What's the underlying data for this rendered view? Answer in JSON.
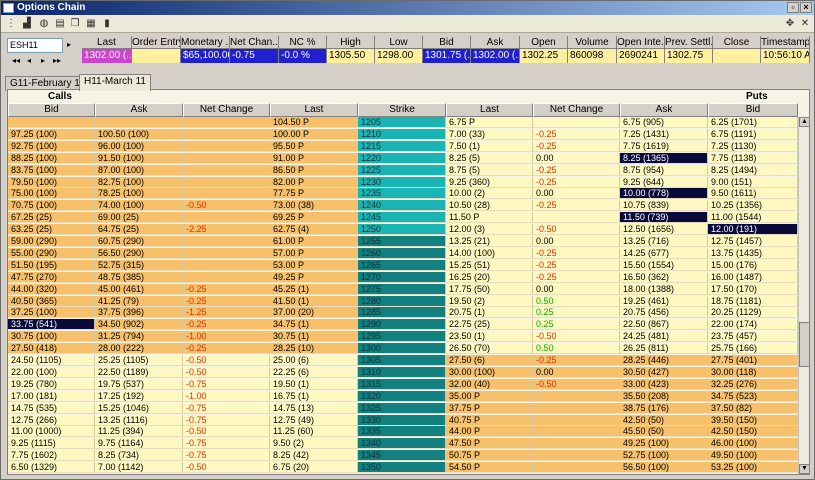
{
  "window": {
    "title": "Options Chain"
  },
  "symbol": {
    "value": "ESH11"
  },
  "quote": {
    "headers": [
      "Last",
      "Order Entry",
      "Monetary ...",
      "Net Chan...",
      "NC %",
      "High",
      "Low",
      "Bid",
      "Ask",
      "Open",
      "Volume",
      "Open Inte...",
      "Prev. Settl...",
      "Close",
      "Timestamp"
    ],
    "values": [
      "1302.00 (...",
      "",
      "$65,100.00",
      "-0.75",
      "-0.0 %",
      "1305.50",
      "1298.00",
      "1301.75 (...",
      "1302.00 (...",
      "1302.25",
      "860098",
      "2690241",
      "1302.75",
      "",
      "10:56:10 A..."
    ]
  },
  "tabs": [
    {
      "label": "G11-February 11",
      "active": false
    },
    {
      "label": "H11-March 11",
      "active": true
    }
  ],
  "sections": {
    "calls": "Calls",
    "puts": "Puts"
  },
  "columns": [
    "Bid",
    "Ask",
    "Net Change",
    "Last",
    "Strike",
    "Last",
    "Net Change",
    "Ask",
    "Bid"
  ],
  "colors": {
    "itm": "#f7c06a",
    "otm": "#fff8c0",
    "strike_a": "#1bb4b4",
    "strike_b": "#128080",
    "selected": "#0a0a3a"
  },
  "rows": [
    [
      "",
      "",
      "",
      "104.50 P",
      "1205",
      "6.75 P",
      "",
      "6.75 (905)",
      "6.25 (1701)"
    ],
    [
      "97.25 (100)",
      "100.50 (100)",
      "",
      "100.00 P",
      "1210",
      "7.00 (33)",
      "-0.25",
      "7.25 (1431)",
      "6.75 (1191)"
    ],
    [
      "92.75 (100)",
      "96.00 (100)",
      "",
      "95.50 P",
      "1215",
      "7.50 (1)",
      "-0.25",
      "7.75 (1619)",
      "7.25 (1130)"
    ],
    [
      "88.25 (100)",
      "91.50 (100)",
      "",
      "91.00 P",
      "1220",
      "8.25 (5)",
      "0.00",
      "8.25 (1365)",
      "7.75 (1138)"
    ],
    [
      "83.75 (100)",
      "87.00 (100)",
      "",
      "86.50 P",
      "1225",
      "8.75 (5)",
      "-0.25",
      "8.75 (954)",
      "8.25 (1494)"
    ],
    [
      "79.50 (100)",
      "82.75 (100)",
      "",
      "82.00 P",
      "1230",
      "9.25 (360)",
      "-0.25",
      "9.25 (644)",
      "9.00 (151)"
    ],
    [
      "75.00 (100)",
      "78.25 (100)",
      "",
      "77.75 P",
      "1235",
      "10.00 (2)",
      "0.00",
      "10.00 (778)",
      "9.50 (1611)"
    ],
    [
      "70.75 (100)",
      "74.00 (100)",
      "-0.50",
      "73.00 (38)",
      "1240",
      "10.50 (28)",
      "-0.25",
      "10.75 (839)",
      "10.25 (1356)"
    ],
    [
      "67.25 (25)",
      "69.00 (25)",
      "",
      "69.25 P",
      "1245",
      "11.50 P",
      "",
      "11.50 (739)",
      "11.00 (1544)"
    ],
    [
      "63.25 (25)",
      "64.75 (25)",
      "-2.25",
      "62.75 (4)",
      "1250",
      "12.00 (3)",
      "-0.50",
      "12.50 (1656)",
      "12.00 (191)"
    ],
    [
      "59.00 (290)",
      "60.75 (290)",
      "",
      "61.00 P",
      "1255",
      "13.25 (21)",
      "0.00",
      "13.25 (716)",
      "12.75 (1457)"
    ],
    [
      "55.00 (290)",
      "56.50 (290)",
      "",
      "57.00 P",
      "1260",
      "14.00 (100)",
      "-0.25",
      "14.25 (677)",
      "13.75 (1435)"
    ],
    [
      "51.50 (195)",
      "52.75 (315)",
      "",
      "53.00 P",
      "1265",
      "15.25 (51)",
      "-0.25",
      "15.50 (1554)",
      "15.00 (176)"
    ],
    [
      "47.75 (270)",
      "48.75 (385)",
      "",
      "49.25 P",
      "1270",
      "16.25 (20)",
      "-0.25",
      "16.50 (362)",
      "16.00 (1487)"
    ],
    [
      "44.00 (320)",
      "45.00 (461)",
      "-0.25",
      "45.25 (1)",
      "1275",
      "17.75 (50)",
      "0.00",
      "18.00 (1388)",
      "17.50 (170)"
    ],
    [
      "40.50 (365)",
      "41.25 (79)",
      "-0.25",
      "41.50 (1)",
      "1280",
      "19.50 (2)",
      "0.50",
      "19.25 (461)",
      "18.75 (1181)"
    ],
    [
      "37.25 (100)",
      "37.75 (396)",
      "-1.25",
      "37.00 (20)",
      "1285",
      "20.75 (1)",
      "0.25",
      "20.75 (456)",
      "20.25 (1129)"
    ],
    [
      "33.75 (541)",
      "34.50 (902)",
      "-0.25",
      "34.75 (1)",
      "1290",
      "22.75 (25)",
      "0.25",
      "22.50 (867)",
      "22.00 (174)"
    ],
    [
      "30.75 (100)",
      "31.25 (794)",
      "-1.00",
      "30.75 (1)",
      "1295",
      "23.50 (1)",
      "-0.50",
      "24.25 (481)",
      "23.75 (457)"
    ],
    [
      "27.50 (418)",
      "28.00 (222)",
      "-0.25",
      "28.25 (10)",
      "1300",
      "26.50 (70)",
      "0.50",
      "26.25 (811)",
      "25.75 (166)"
    ],
    [
      "24.50 (1105)",
      "25.25 (1105)",
      "-0.50",
      "25.00 (6)",
      "1305",
      "27.50 (6)",
      "-0.25",
      "28.25 (446)",
      "27.75 (401)"
    ],
    [
      "22.00 (100)",
      "22.50 (1189)",
      "-0.50",
      "22.25 (6)",
      "1310",
      "30.00 (100)",
      "0.00",
      "30.50 (427)",
      "30.00 (118)"
    ],
    [
      "19.25 (780)",
      "19.75 (537)",
      "-0.75",
      "19.50 (1)",
      "1315",
      "32.00 (40)",
      "-0.50",
      "33.00 (423)",
      "32.25 (276)"
    ],
    [
      "17.00 (181)",
      "17.25 (192)",
      "-1.00",
      "16.75 (1)",
      "1320",
      "35.00 P",
      "",
      "35.50 (208)",
      "34.75 (523)"
    ],
    [
      "14.75 (535)",
      "15.25 (1046)",
      "-0.75",
      "14.75 (13)",
      "1325",
      "37.75 P",
      "",
      "38.75 (176)",
      "37.50 (82)"
    ],
    [
      "12.75 (266)",
      "13.25 (1116)",
      "-0.75",
      "12.75 (49)",
      "1330",
      "40.75 P",
      "",
      "42.50 (50)",
      "39.50 (150)"
    ],
    [
      "11.00 (1000)",
      "11.25 (394)",
      "-0.50",
      "11.25 (60)",
      "1335",
      "44.00 P",
      "",
      "45.50 (50)",
      "42.50 (150)"
    ],
    [
      "9.25 (1115)",
      "9.75 (1164)",
      "-0.75",
      "9.50 (2)",
      "1340",
      "47.50 P",
      "",
      "49.25 (100)",
      "46.00 (100)"
    ],
    [
      "7.75 (1602)",
      "8.25 (734)",
      "-0.75",
      "8.25 (42)",
      "1345",
      "50.75 P",
      "",
      "52.75 (100)",
      "49.50 (100)"
    ],
    [
      "6.50 (1329)",
      "7.00 (1142)",
      "-0.50",
      "6.75 (20)",
      "1350",
      "54.50 P",
      "",
      "56.50 (100)",
      "53.25 (100)"
    ]
  ]
}
